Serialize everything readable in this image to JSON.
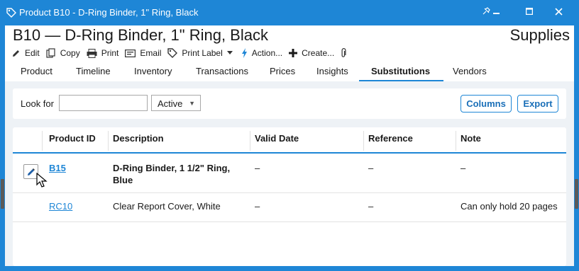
{
  "window": {
    "title": "Product B10 - D-Ring Binder, 1\" Ring, Black",
    "controls": [
      "pin-icon",
      "minimize-icon",
      "maximize-icon",
      "close-icon"
    ]
  },
  "header": {
    "title": "B10 — D-Ring Binder, 1\" Ring, Black",
    "category": "Supplies"
  },
  "toolbar": {
    "edit": "Edit",
    "copy": "Copy",
    "print": "Print",
    "email": "Email",
    "print_label": "Print Label",
    "action": "Action...",
    "create": "Create..."
  },
  "tabs": [
    {
      "label": "Product"
    },
    {
      "label": "Timeline"
    },
    {
      "label": "Inventory"
    },
    {
      "label": "Transactions"
    },
    {
      "label": "Prices"
    },
    {
      "label": "Insights"
    },
    {
      "label": "Substitutions",
      "active": true
    },
    {
      "label": "Vendors"
    }
  ],
  "filter": {
    "look_for_label": "Look for",
    "look_for_value": "",
    "status": "Active",
    "columns_button": "Columns",
    "export_button": "Export"
  },
  "grid": {
    "columns": [
      "Product ID",
      "Description",
      "Valid Date",
      "Reference",
      "Note"
    ],
    "rows": [
      {
        "product_id": "B15",
        "description_line1": "D-Ring Binder, 1 1/2\" Ring,",
        "description_line2": "Blue",
        "valid_date": "–",
        "reference": "–",
        "note": "–"
      },
      {
        "product_id": "RC10",
        "description": "Clear Report Cover, White",
        "valid_date": "–",
        "reference": "–",
        "note": "Can only hold 20 pages"
      }
    ]
  },
  "colors": {
    "accent": "#1e86d6",
    "link": "#1e86d6",
    "pane_background": "#eef2f6"
  }
}
